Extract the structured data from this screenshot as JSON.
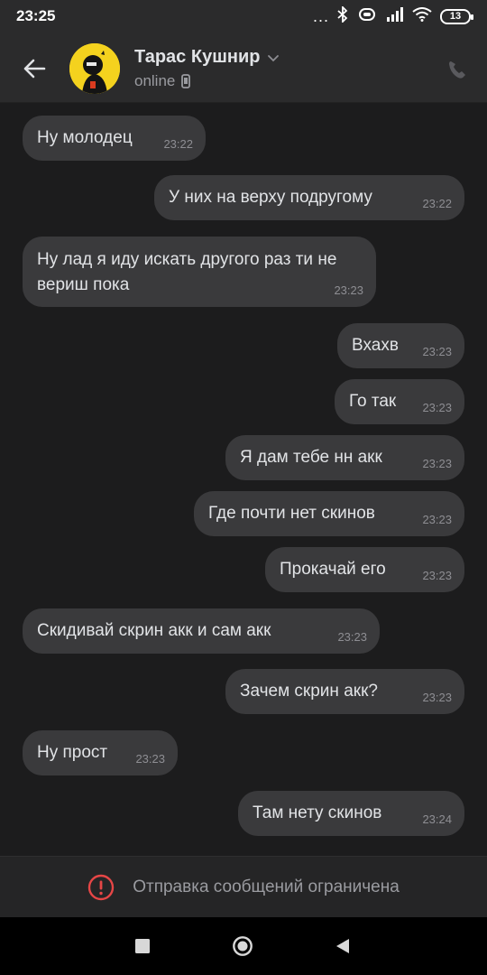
{
  "status_bar": {
    "time": "23:25",
    "battery": "13",
    "dots": "..."
  },
  "header": {
    "contact_name": "Тарас Кушнир",
    "status": "online",
    "back_icon": "arrow-left-icon",
    "call_icon": "phone-icon"
  },
  "messages": [
    {
      "side": "in",
      "text": "Ну молодец",
      "time": "23:22"
    },
    {
      "side": "out",
      "text": "У них на верху подругому",
      "time": "23:22"
    },
    {
      "side": "in",
      "text": "Ну лад я иду искать другого раз ти не вериш пока",
      "time": "23:23"
    },
    {
      "side": "out",
      "text": "Вхахв",
      "time": "23:23"
    },
    {
      "side": "out",
      "text": "Го так",
      "time": "23:23"
    },
    {
      "side": "out",
      "text": "Я дам тебе нн акк",
      "time": "23:23"
    },
    {
      "side": "out",
      "text": "Где почти нет скинов",
      "time": "23:23"
    },
    {
      "side": "out",
      "text": "Прокачай его",
      "time": "23:23"
    },
    {
      "side": "in",
      "text": "Скидивай скрин акк и сам акк",
      "time": "23:23"
    },
    {
      "side": "out",
      "text": "Зачем скрин акк?",
      "time": "23:23"
    },
    {
      "side": "in",
      "text": "Ну прост",
      "time": "23:23"
    },
    {
      "side": "out",
      "text": "Там нету скинов",
      "time": "23:24"
    }
  ],
  "composer": {
    "notice": "Отправка сообщений ограничена",
    "icon": "warning-circle-icon"
  },
  "colors": {
    "background": "#1c1c1d",
    "header": "#2b2b2c",
    "bubble": "#3a3a3c",
    "accent_warning": "#e64646",
    "avatar_bg": "#f4d21e"
  }
}
